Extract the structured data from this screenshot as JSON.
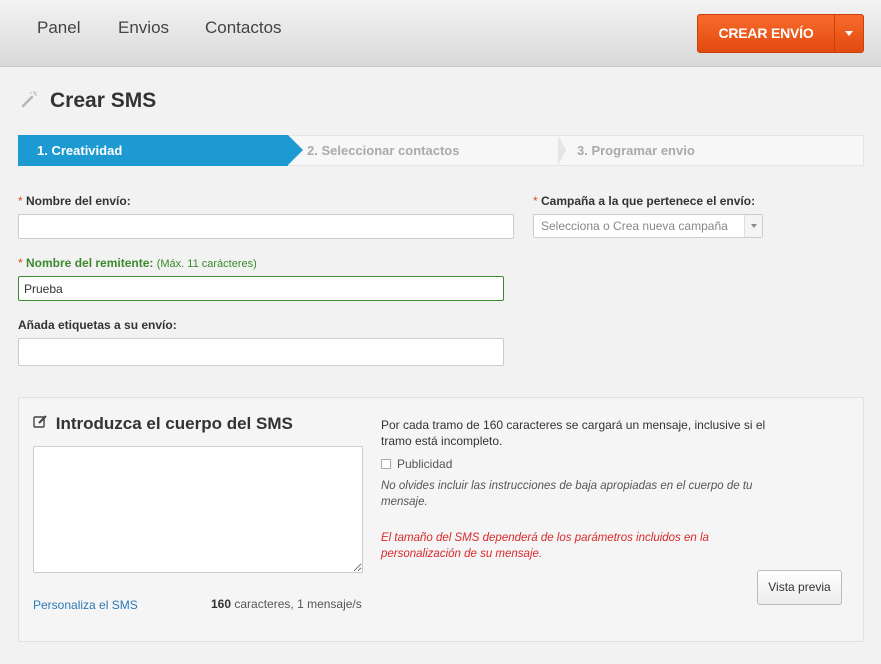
{
  "nav": {
    "items": [
      "Panel",
      "Envios",
      "Contactos"
    ],
    "create_label": "CREAR ENVÍO"
  },
  "page": {
    "title": "Crear SMS"
  },
  "steps": [
    "1. Creatividad",
    "2. Seleccionar contactos",
    "3. Programar envio"
  ],
  "form": {
    "required_mark": "*",
    "name_label": "Nombre del envío:",
    "name_value": "",
    "campaign_label": "Campaña a la que pertenece el envío:",
    "campaign_placeholder": "Selecciona o Crea nueva campaña",
    "sender_label": "Nombre del remitente:",
    "sender_hint": "(Máx. 11 carácteres)",
    "sender_value": "Prueba",
    "tags_label": "Añada etiquetas a su envío:",
    "tags_value": ""
  },
  "sms": {
    "title": "Introduzca el cuerpo del SMS",
    "body": "",
    "personalize_link": "Personaliza el SMS",
    "char_count": "160",
    "char_text": "caracteres, 1 mensaje/s",
    "info_tramo": "Por cada tramo de 160 caracteres se cargará un mensaje, inclusive si el tramo está incompleto.",
    "publicidad_label": "Publicidad",
    "publicidad_checked": false,
    "info_baja": "No olvides incluir las instrucciones de baja apropiadas en el cuerpo de tu mensaje.",
    "info_tamano": "El tamaño del SMS dependerá de los parámetros incluidos en la personalización de su mensaje.",
    "preview_label": "Vista previa"
  },
  "colors": {
    "accent_orange": "#e24a10",
    "step_active": "#1e9ad3",
    "valid_green": "#3c8a2e",
    "warning_red": "#d9292b"
  }
}
